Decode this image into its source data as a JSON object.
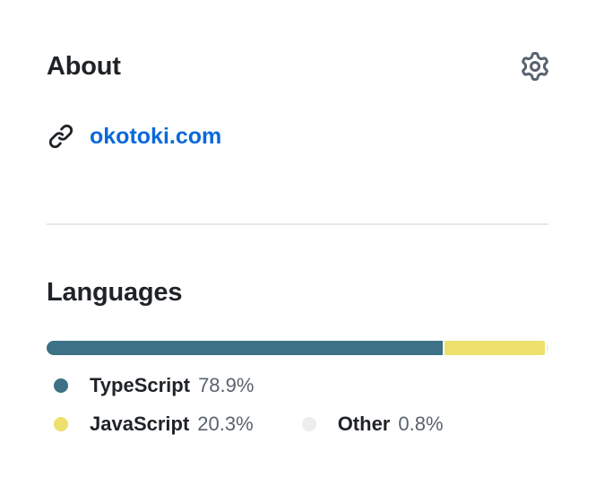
{
  "about": {
    "title": "About",
    "settings_icon": "gear-icon",
    "website": {
      "icon": "link-icon",
      "label": "okotoki.com"
    }
  },
  "languages": {
    "title": "Languages",
    "items": [
      {
        "name": "TypeScript",
        "percent_label": "78.9%",
        "percent": 78.9,
        "color": "#3178c6",
        "bar_color": "#3c7186"
      },
      {
        "name": "JavaScript",
        "percent_label": "20.3%",
        "percent": 20.3,
        "color": "#f1e05a",
        "bar_color": "#ede06d"
      },
      {
        "name": "Other",
        "percent_label": "0.8%",
        "percent": 0.8,
        "color": "#ededed",
        "bar_color": "#ededed"
      }
    ]
  }
}
